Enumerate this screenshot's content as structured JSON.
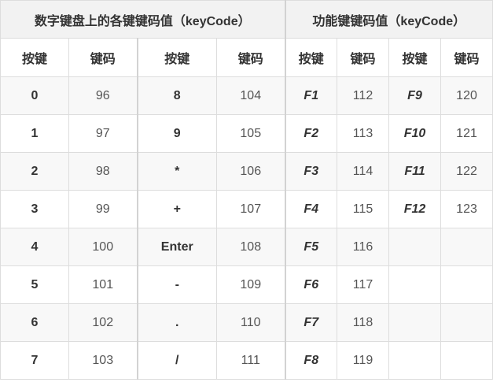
{
  "headers": {
    "numpad_title": "数字键盘上的各键键码值（keyCode）",
    "fkeys_title": "功能键键码值（keyCode）",
    "key_label": "按键",
    "code_label": "键码"
  },
  "rows": [
    {
      "k1": "0",
      "c1": "96",
      "k2": "8",
      "c2": "104",
      "k3": "F1",
      "c3": "112",
      "k4": "F9",
      "c4": "120"
    },
    {
      "k1": "1",
      "c1": "97",
      "k2": "9",
      "c2": "105",
      "k3": "F2",
      "c3": "113",
      "k4": "F10",
      "c4": "121"
    },
    {
      "k1": "2",
      "c1": "98",
      "k2": "*",
      "c2": "106",
      "k3": "F3",
      "c3": "114",
      "k4": "F11",
      "c4": "122"
    },
    {
      "k1": "3",
      "c1": "99",
      "k2": "+",
      "c2": "107",
      "k3": "F4",
      "c3": "115",
      "k4": "F12",
      "c4": "123"
    },
    {
      "k1": "4",
      "c1": "100",
      "k2": "Enter",
      "c2": "108",
      "k3": "F5",
      "c3": "116",
      "k4": "",
      "c4": ""
    },
    {
      "k1": "5",
      "c1": "101",
      "k2": "-",
      "c2": "109",
      "k3": "F6",
      "c3": "117",
      "k4": "",
      "c4": ""
    },
    {
      "k1": "6",
      "c1": "102",
      "k2": ".",
      "c2": "110",
      "k3": "F7",
      "c3": "118",
      "k4": "",
      "c4": ""
    },
    {
      "k1": "7",
      "c1": "103",
      "k2": "/",
      "c2": "111",
      "k3": "F8",
      "c3": "119",
      "k4": "",
      "c4": ""
    }
  ]
}
